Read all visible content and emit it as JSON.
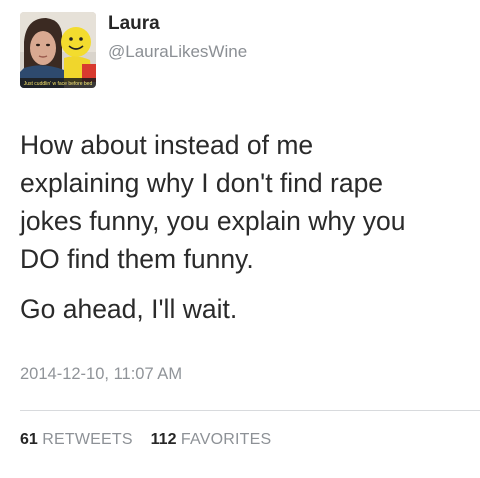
{
  "author": {
    "display_name": "Laura",
    "handle": "@LauraLikesWine",
    "avatar_caption": "Just cuddlin' w face before bed"
  },
  "tweet": {
    "paragraphs": [
      "How about instead of me|explaining why I don't find rape|jokes funny, you explain why you|DO find them funny.",
      "Go ahead, I'll wait."
    ],
    "line1": "How about instead of me",
    "line2": "explaining why I don't find rape",
    "line3": "jokes funny, you explain why you",
    "line4": "DO find them funny.",
    "line5": "Go ahead, I'll wait.",
    "timestamp": "2014-12-10, 11:07 AM"
  },
  "stats": {
    "retweets_count": "61",
    "retweets_label": "RETWEETS",
    "favorites_count": "112",
    "favorites_label": "FAVORITES"
  },
  "colors": {
    "name": "#262626",
    "secondary_text": "#8b8f94",
    "body_text": "#2a2a2a",
    "divider": "#d8dadd"
  }
}
